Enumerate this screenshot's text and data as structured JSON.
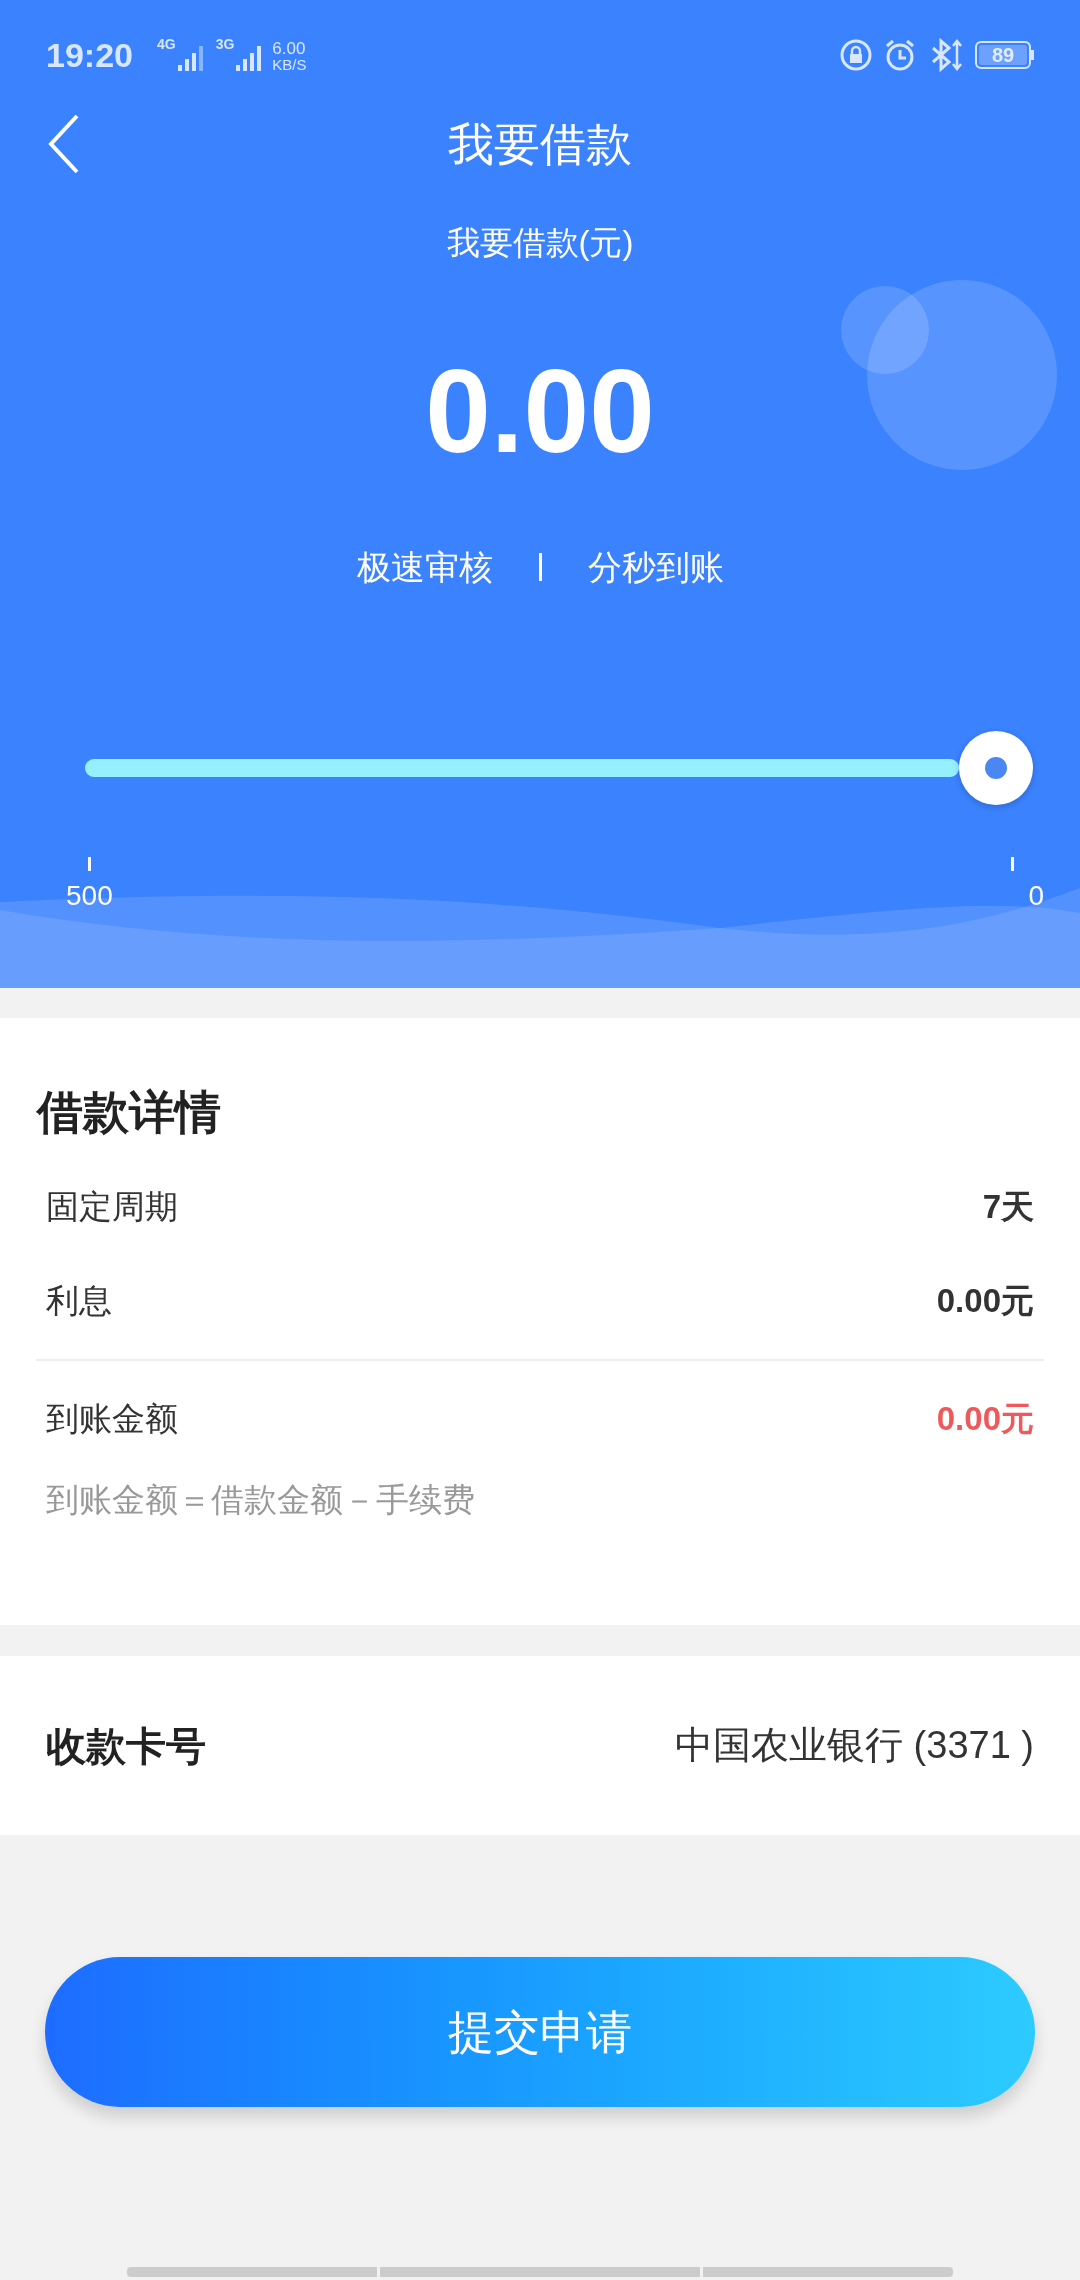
{
  "status_bar": {
    "time": "19:20",
    "net1": "4G",
    "net2": "3G",
    "speed_value": "6.00",
    "speed_unit": "KB/S",
    "battery": "89"
  },
  "header": {
    "title": "我要借款",
    "subtitle": "我要借款(元)",
    "amount": "0.00",
    "features": [
      "极速审核",
      "分秒到账"
    ]
  },
  "slider": {
    "level": 1,
    "min_label": "500",
    "max_label": "0"
  },
  "details": {
    "title": "借款详情",
    "rows": [
      {
        "label": "固定周期",
        "value": "7天",
        "kind": "plain"
      },
      {
        "label": "利息",
        "value": "0.00元",
        "kind": "plain"
      },
      {
        "label": "到账金额",
        "value": "0.00元",
        "kind": "highlight"
      }
    ],
    "note": "到账金额＝借款金额－手续费"
  },
  "card": {
    "label": "收款卡号",
    "value": "中国农业银行 (3371 )"
  },
  "submit_button": "提交申请"
}
